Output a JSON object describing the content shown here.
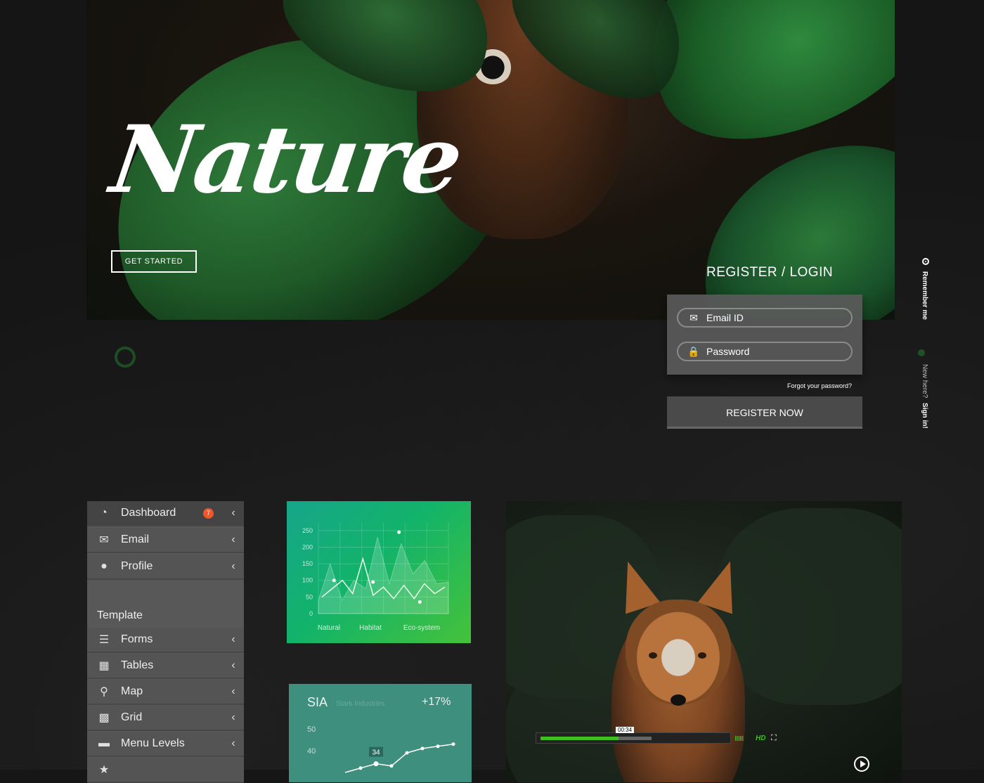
{
  "hero": {
    "title": "Nature",
    "cta_label": "GET STARTED"
  },
  "login": {
    "heading": "REGISTER / LOGIN",
    "email_placeholder": "Email ID",
    "password_placeholder": "Password",
    "forgot": "Forgot your password?",
    "register_button": "REGISTER NOW",
    "remember_me": "Remember me",
    "new_here": "New here?",
    "sign_in": "Sign in!"
  },
  "sidebar": {
    "items": [
      {
        "label": "Dashboard",
        "icon": "dashboard-icon",
        "badge": "7"
      },
      {
        "label": "Email",
        "icon": "mail-icon"
      },
      {
        "label": "Profile",
        "icon": "user-icon"
      }
    ],
    "section_title": "Template",
    "template_items": [
      {
        "label": "Forms",
        "icon": "forms-icon"
      },
      {
        "label": "Tables",
        "icon": "table-icon"
      },
      {
        "label": "Map",
        "icon": "map-pin-icon"
      },
      {
        "label": "Grid",
        "icon": "grid-icon"
      },
      {
        "label": "Menu Levels",
        "icon": "folder-icon"
      }
    ]
  },
  "chart_data": [
    {
      "type": "line",
      "categories": [
        "Natural",
        "Habitat",
        "Eco-system"
      ],
      "yticks": [
        0,
        50,
        100,
        150,
        200,
        250
      ],
      "ylim": [
        0,
        275
      ],
      "series": [
        {
          "values": [
            50,
            75,
            100,
            60,
            165,
            55,
            80,
            45,
            85,
            45,
            90,
            60,
            80
          ]
        },
        {
          "values": [
            40,
            150,
            40,
            100,
            75,
            230,
            90,
            210,
            120,
            160,
            90,
            95
          ]
        }
      ],
      "points": [
        {
          "x": 0.12,
          "y": 100
        },
        {
          "x": 0.42,
          "y": 95
        },
        {
          "x": 0.62,
          "y": 245
        },
        {
          "x": 0.78,
          "y": 35
        }
      ],
      "grid": true
    },
    {
      "type": "line",
      "title": "SIA",
      "subtitle": "Stark Industries",
      "change": "+17%",
      "yticks": [
        40,
        50
      ],
      "callout": "34",
      "series": [
        {
          "values": [
            30,
            32,
            34,
            33,
            39,
            41,
            42,
            43
          ]
        }
      ]
    }
  ],
  "video": {
    "current_time": "00:34",
    "progress": 0.42,
    "buffered": 0.6,
    "volume_bars": "IIIIIII",
    "hd_label": "HD"
  },
  "colors": {
    "accent_green": "#3ec11f",
    "badge_orange": "#f0562c",
    "card_teal": "#3f8f7f"
  }
}
